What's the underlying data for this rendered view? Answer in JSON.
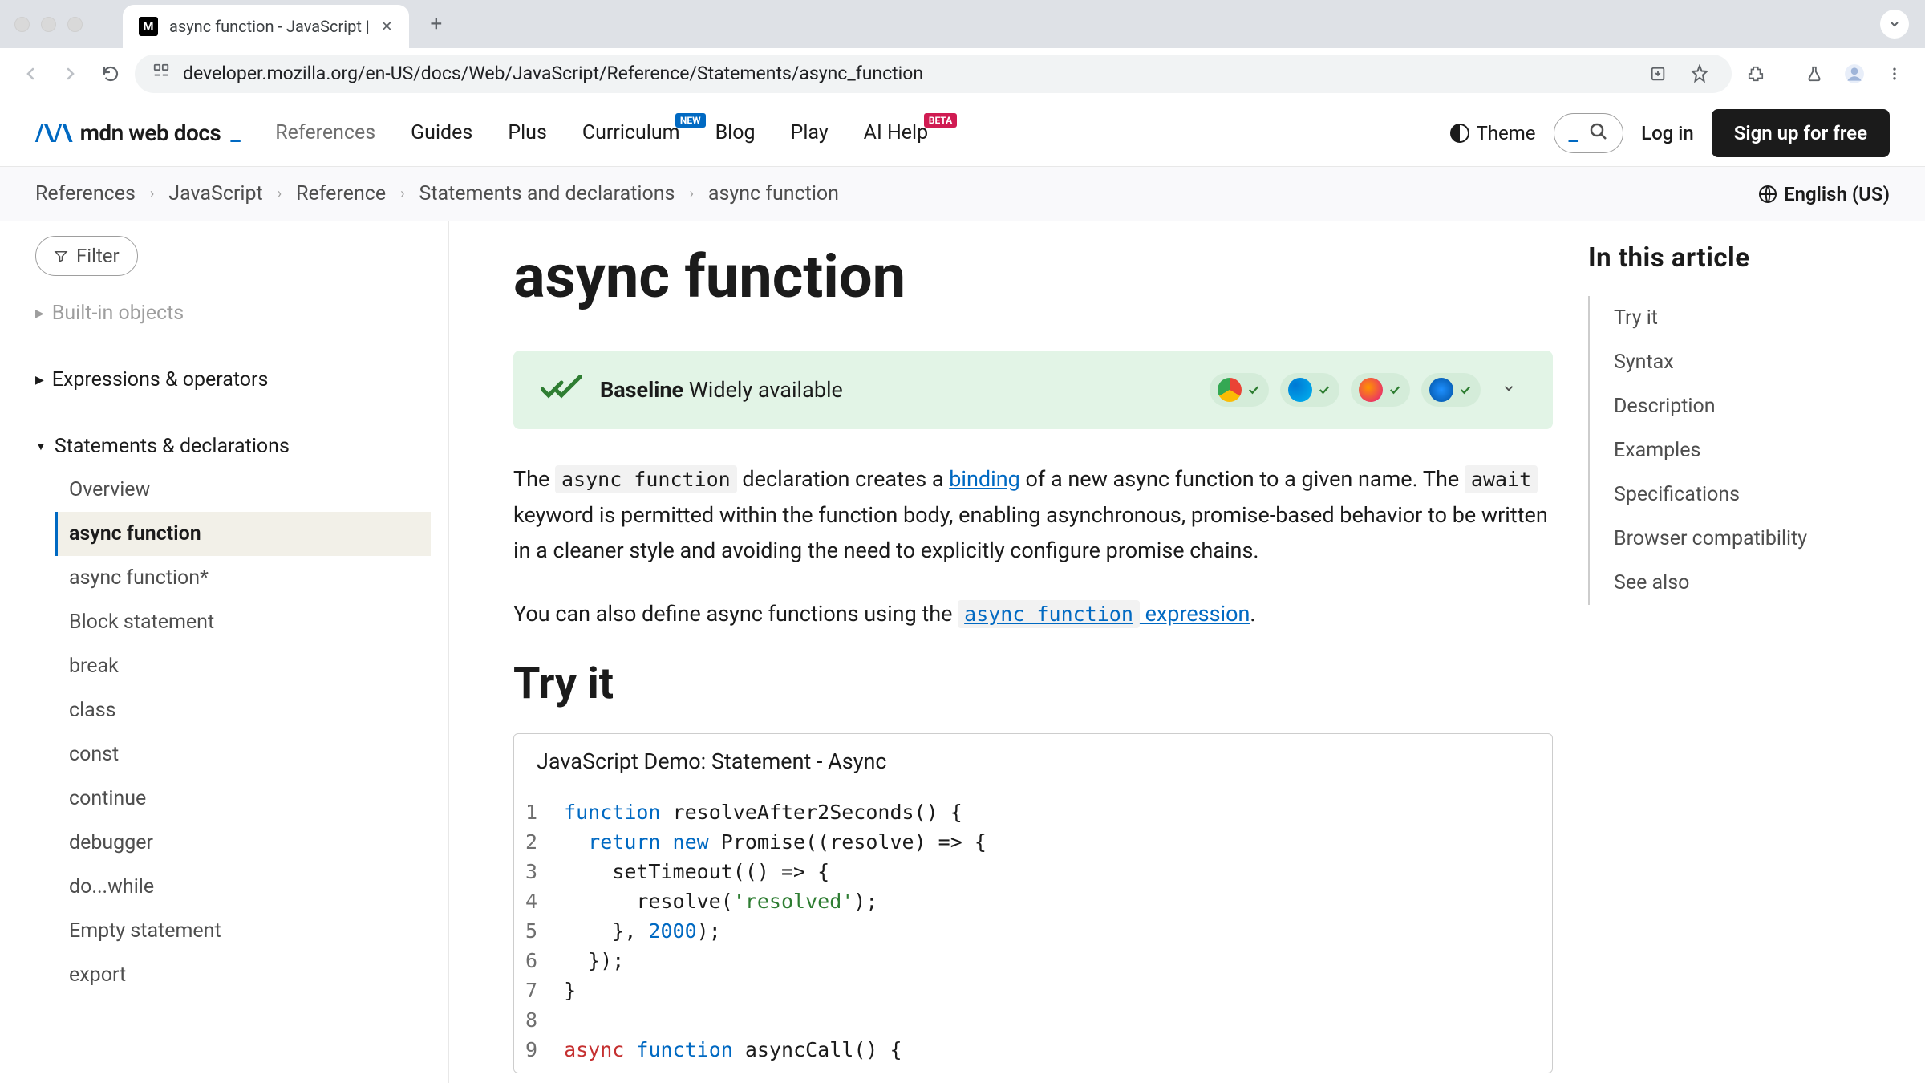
{
  "browser": {
    "tab_title": "async function - JavaScript |",
    "url": "developer.mozilla.org/en-US/docs/Web/JavaScript/Reference/Statements/async_function"
  },
  "header": {
    "logo_text": "mdn web docs",
    "nav": {
      "references": "References",
      "guides": "Guides",
      "plus": "Plus",
      "curriculum": "Curriculum",
      "curriculum_badge": "NEW",
      "blog": "Blog",
      "play": "Play",
      "ai_help": "AI Help",
      "ai_help_badge": "BETA"
    },
    "theme_label": "Theme",
    "login": "Log in",
    "signup": "Sign up for free"
  },
  "breadcrumb": {
    "items": [
      "References",
      "JavaScript",
      "Reference",
      "Statements and declarations",
      "async function"
    ],
    "locale": "English (US)"
  },
  "sidebar": {
    "filter_label": "Filter",
    "groups": {
      "builtin": "Built-in objects",
      "expressions": "Expressions & operators",
      "statements": "Statements & declarations"
    },
    "items": [
      "Overview",
      "async function",
      "async function*",
      "Block statement",
      "break",
      "class",
      "const",
      "continue",
      "debugger",
      "do...while",
      "Empty statement",
      "export"
    ]
  },
  "page": {
    "title": "async function",
    "baseline_label": "Baseline",
    "baseline_status": " Widely available",
    "intro_1a": "The ",
    "intro_1_code1": "async function",
    "intro_1b": " declaration creates a ",
    "intro_1_link": "binding",
    "intro_1c": " of a new async function to a given name. The ",
    "intro_1_code2": "await",
    "intro_1d": " keyword is permitted within the function body, enabling asynchronous, promise-based behavior to be written in a cleaner style and avoiding the need to explicitly configure promise chains.",
    "intro_2a": "You can also define async functions using the ",
    "intro_2_linkcode": "async function",
    "intro_2_linktext": " expression",
    "intro_2b": ".",
    "try_it_heading": "Try it",
    "demo_title": "JavaScript Demo: Statement - Async",
    "code": {
      "l1": {
        "a": "function",
        "b": " resolveAfter2Seconds() {"
      },
      "l2": {
        "a": "  ",
        "b": "return",
        "c": " ",
        "d": "new",
        "e": " Promise((resolve) => {"
      },
      "l3": "    setTimeout(() => {",
      "l4": {
        "a": "      resolve(",
        "b": "'resolved'",
        "c": ");"
      },
      "l5": {
        "a": "    }, ",
        "b": "2000",
        "c": ");"
      },
      "l6": "  });",
      "l7": "}",
      "l8": "",
      "l9": {
        "a": "async",
        "b": " ",
        "c": "function",
        "d": " asyncCall() {"
      }
    }
  },
  "toc": {
    "title": "In this article",
    "items": [
      "Try it",
      "Syntax",
      "Description",
      "Examples",
      "Specifications",
      "Browser compatibility",
      "See also"
    ]
  }
}
